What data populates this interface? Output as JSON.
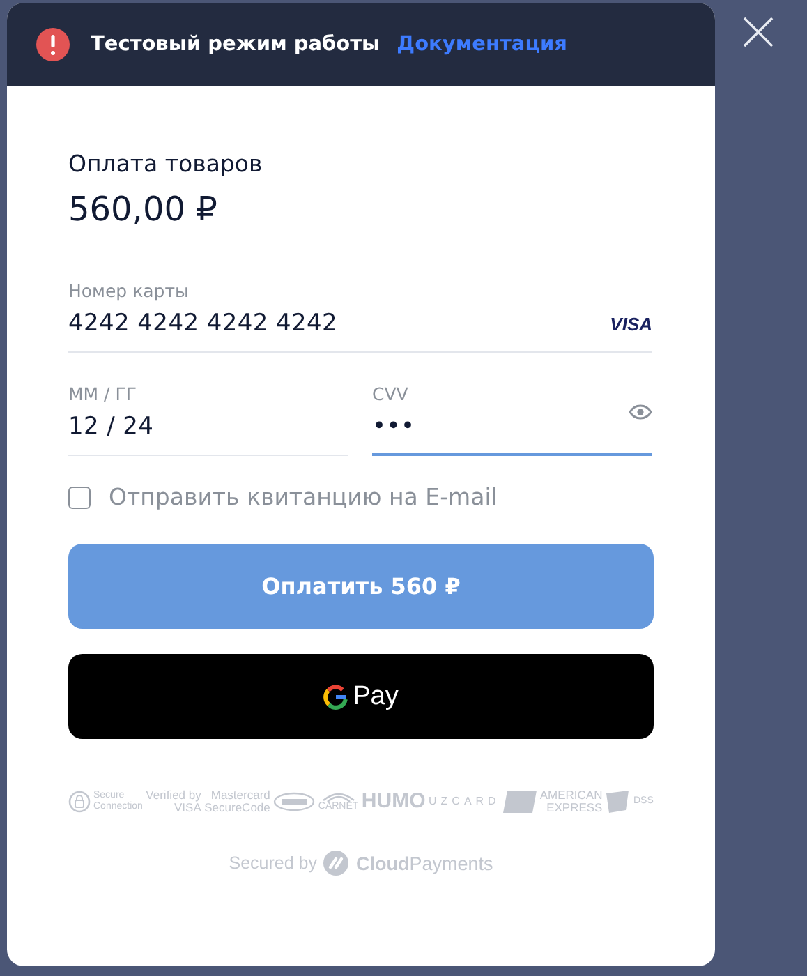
{
  "header": {
    "title": "Тестовый режим работы",
    "link": "Документация"
  },
  "payment": {
    "title": "Оплата товаров",
    "amount": "560,00 ₽"
  },
  "fields": [
    {
      "kind": "card",
      "label": "Номер карты",
      "value": "4242 4242 4242 4242",
      "brand": "VISA",
      "focused": false
    },
    {
      "kind": "expiry",
      "label": "ММ / ГГ",
      "value": "12 / 24",
      "focused": false
    },
    {
      "kind": "cvv",
      "label": "CVV",
      "value": "•••",
      "focused": true
    }
  ],
  "receipt": {
    "label": "Отправить квитанцию на E-mail",
    "checked": false
  },
  "pay_button": "Оплатить 560 ₽",
  "gpay": {
    "label": "Pay"
  },
  "badges": [
    {
      "kind": "lock",
      "lines": [
        "Secure",
        "Connection"
      ]
    },
    {
      "kind": "text",
      "lines": [
        "Verified by",
        "VISA"
      ]
    },
    {
      "kind": "text",
      "lines": [
        "Mastercard",
        "SecureCode"
      ]
    },
    {
      "kind": "oval"
    },
    {
      "kind": "arc",
      "lines": [
        "CARNET"
      ]
    },
    {
      "kind": "big",
      "lines": [
        "HUMO"
      ]
    },
    {
      "kind": "spaced",
      "lines": [
        "UZCARD"
      ]
    },
    {
      "kind": "card"
    },
    {
      "kind": "text",
      "lines": [
        "AMERICAN",
        "EXPRESS"
      ]
    },
    {
      "kind": "shield",
      "lines": [
        "DSS"
      ]
    }
  ],
  "footer": {
    "prefix": "Secured by",
    "brand": "**Cloud**Payments"
  }
}
